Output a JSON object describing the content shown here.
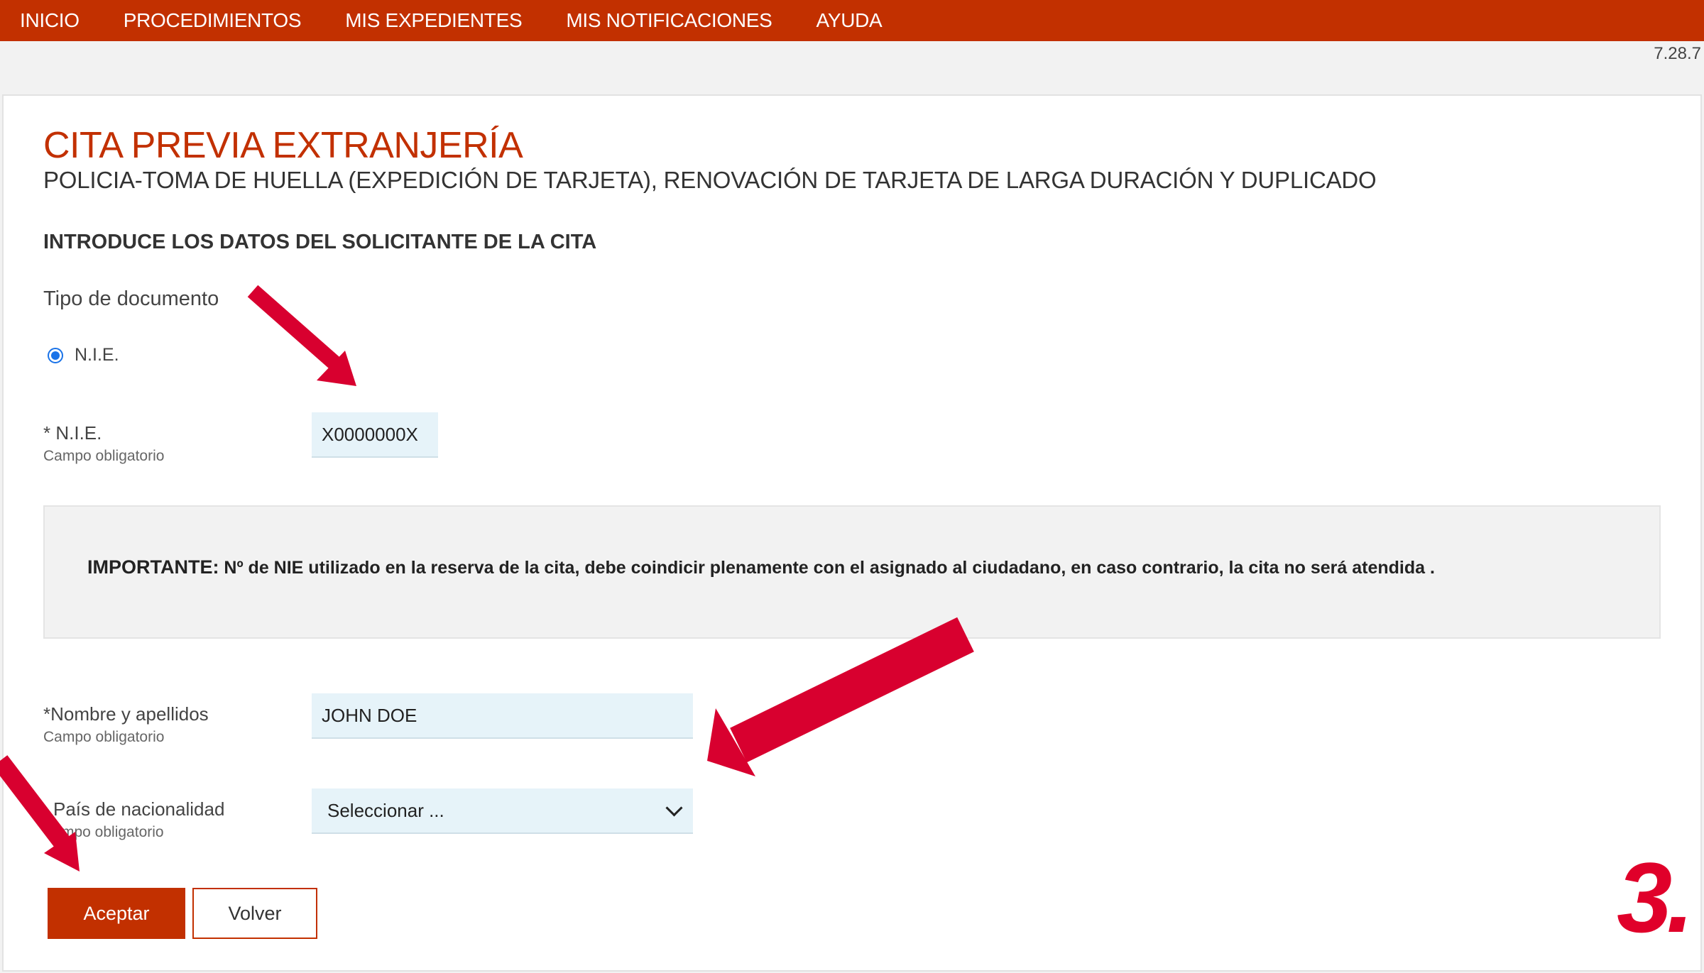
{
  "nav": {
    "items": [
      {
        "label": "INICIO"
      },
      {
        "label": "PROCEDIMIENTOS"
      },
      {
        "label": "MIS EXPEDIENTES"
      },
      {
        "label": "MIS NOTIFICACIONES"
      },
      {
        "label": "AYUDA"
      }
    ]
  },
  "version": "7.28.7",
  "page": {
    "title": "CITA PREVIA EXTRANJERÍA",
    "subtitle": "POLICIA-TOMA DE HUELLA (EXPEDICIÓN DE TARJETA), RENOVACIÓN DE TARJETA DE LARGA DURACIÓN Y DUPLICADO",
    "section_heading": "INTRODUCE LOS DATOS DEL SOLICITANTE DE LA CITA"
  },
  "form": {
    "doc_type_label": "Tipo de documento",
    "doc_type_option": "N.I.E.",
    "nie": {
      "label": "* N.I.E.",
      "hint": "Campo obligatorio",
      "value": "X0000000X"
    },
    "important": {
      "strong": "IMPORTANTE:",
      "text": " Nº de NIE utilizado en la reserva de la cita, debe coindicir plenamente con el asignado al ciudadano, en caso contrario, la cita no será atendida ."
    },
    "name": {
      "label": "*Nombre y apellidos",
      "hint": "Campo obligatorio",
      "value": "JOHN DOE"
    },
    "country": {
      "label": "País de nacionalidad",
      "hint": "mpo obligatorio",
      "selected": "Seleccionar ..."
    },
    "accept_label": "Aceptar",
    "back_label": "Volver"
  },
  "annotation": {
    "step": "3.",
    "arrow_color": "#d8002f"
  },
  "colors": {
    "brand": "#c23000",
    "input_bg": "#e6f3f9",
    "radio": "#1a73e8"
  }
}
